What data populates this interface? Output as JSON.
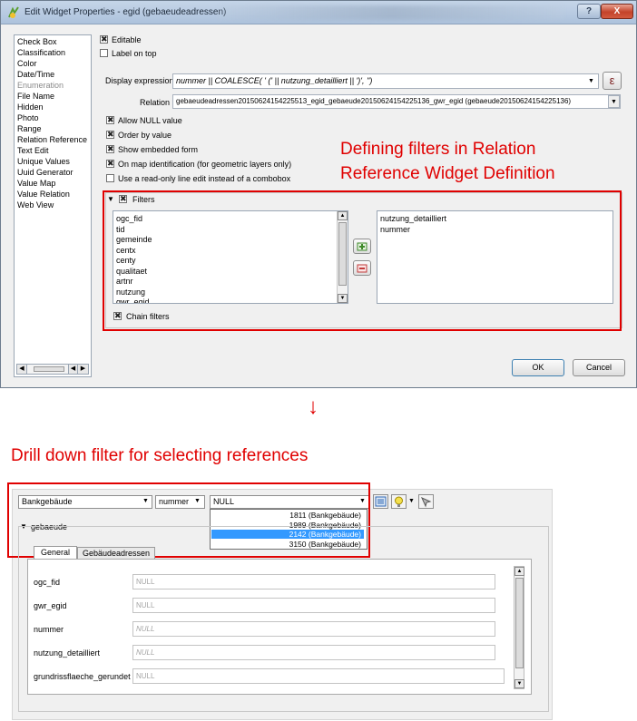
{
  "dialog": {
    "title": "Edit Widget Properties - egid (gebaeudeadressen)",
    "help_label": "?",
    "close_label": "X",
    "widget_types": [
      {
        "label": "Check Box",
        "disabled": false
      },
      {
        "label": "Classification",
        "disabled": false
      },
      {
        "label": "Color",
        "disabled": false
      },
      {
        "label": "Date/Time",
        "disabled": false
      },
      {
        "label": "Enumeration",
        "disabled": true
      },
      {
        "label": "File Name",
        "disabled": false
      },
      {
        "label": "Hidden",
        "disabled": false
      },
      {
        "label": "Photo",
        "disabled": false
      },
      {
        "label": "Range",
        "disabled": false
      },
      {
        "label": "Relation Reference",
        "disabled": false
      },
      {
        "label": "Text Edit",
        "disabled": false
      },
      {
        "label": "Unique Values",
        "disabled": false
      },
      {
        "label": "Uuid Generator",
        "disabled": false
      },
      {
        "label": "Value Map",
        "disabled": false
      },
      {
        "label": "Value Relation",
        "disabled": false
      },
      {
        "label": "Web View",
        "disabled": false
      }
    ],
    "editable_label": "Editable",
    "label_on_top_label": "Label on top",
    "display_expression_label": "Display expression",
    "display_expression_value": "nummer || COALESCE( ' (' || nutzung_detailliert || ')', '')",
    "expression_button_label": "ε",
    "relation_label": "Relation",
    "relation_value": "gebaeudeadressen20150624154225513_egid_gebaeude20150624154225136_gwr_egid (gebaeude20150624154225136)",
    "options": [
      {
        "label": "Allow NULL value",
        "checked": true
      },
      {
        "label": "Order by value",
        "checked": true
      },
      {
        "label": "Show embedded form",
        "checked": true
      },
      {
        "label": "On map identification (for geometric layers only)",
        "checked": true
      },
      {
        "label": "Use a read-only line edit instead of a combobox",
        "checked": false
      }
    ],
    "filters_label": "Filters",
    "available_fields": [
      "ogc_fid",
      "tid",
      "gemeinde",
      "centx",
      "centy",
      "qualitaet",
      "artnr",
      "nutzung",
      "gwr_egid"
    ],
    "selected_fields": [
      "nutzung_detailliert",
      "nummer"
    ],
    "chain_filters_label": "Chain filters",
    "ok_label": "OK",
    "cancel_label": "Cancel"
  },
  "annotations": {
    "filters_line1": "Defining filters in Relation",
    "filters_line2": "Reference Widget Definition",
    "arrow": "↓",
    "drill_down": "Drill down filter for selecting references"
  },
  "form": {
    "filter1_value": "Bankgebäude",
    "filter2_value": "nummer",
    "reference_value": "NULL",
    "dropdown_options": [
      "1811 (Bankgebäude)",
      "1989 (Bankgebäude)",
      "2142 (Bankgebäude)",
      "3150 (Bankgebäude)"
    ],
    "selected_option_index": 2,
    "embedded_group_label": "gebaeude",
    "tabs": [
      "General",
      "Gebäudeadressen"
    ],
    "fields": [
      {
        "label": "ogc_fid",
        "value": "NULL"
      },
      {
        "label": "gwr_egid",
        "value": "NULL"
      },
      {
        "label": "nummer",
        "value": "NULL"
      },
      {
        "label": "nutzung_detailliert",
        "value": "NULL"
      },
      {
        "label": "grundrissflaeche_gerundet",
        "value": "NULL"
      }
    ]
  },
  "colors": {
    "annotation": "#e00000",
    "selection": "#3399ff"
  }
}
